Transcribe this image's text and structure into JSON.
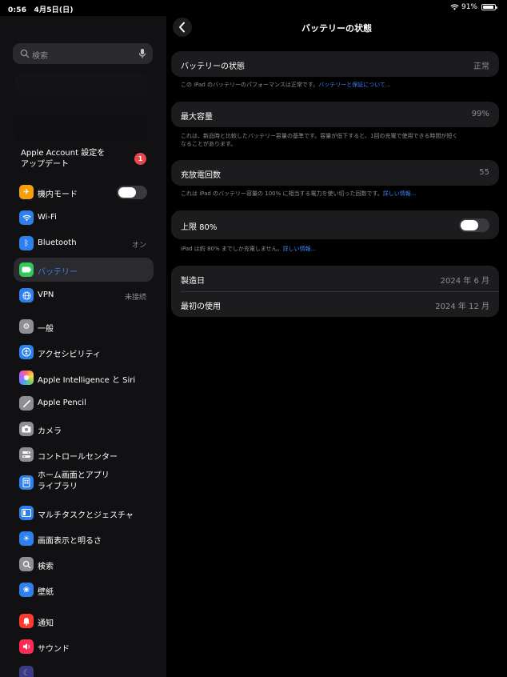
{
  "status_bar": {
    "time": "0:56",
    "date": "4月5日(日)",
    "battery": "91%"
  },
  "sidebar": {
    "search_placeholder": "検索",
    "account": {
      "line1": "Apple Account 設定を",
      "line2": "アップデート",
      "badge": "1"
    },
    "items": [
      {
        "id": "airplane",
        "label": "機内モード",
        "icon": "airplane-icon",
        "color": "#f59e0b",
        "toggle": false
      },
      {
        "id": "wifi",
        "label": "Wi-Fi",
        "icon": "wifi-icon",
        "color": "#2f80ed"
      },
      {
        "id": "bluetooth",
        "label": "Bluetooth",
        "value": "オン",
        "icon": "bluetooth-icon",
        "color": "#2f80ed"
      },
      {
        "id": "battery",
        "label": "バッテリー",
        "icon": "battery-icon",
        "color": "#34c759",
        "selected": true
      },
      {
        "id": "vpn",
        "label": "VPN",
        "value": "未接続",
        "icon": "globe-icon",
        "color": "#2f80ed"
      },
      {
        "id": "general",
        "label": "一般",
        "icon": "gear-icon",
        "color": "#8e8e93"
      },
      {
        "id": "accessibility",
        "label": "アクセシビリティ",
        "icon": "accessibility-icon",
        "color": "#2f80ed"
      },
      {
        "id": "ai",
        "label": "Apple Intelligence と Siri",
        "icon": "siri-icon",
        "color": "#c45cff"
      },
      {
        "id": "pencil",
        "label": "Apple Pencil",
        "icon": "pencil-icon",
        "color": "#8e8e93"
      },
      {
        "id": "camera",
        "label": "カメラ",
        "icon": "camera-icon",
        "color": "#8e8e93"
      },
      {
        "id": "control",
        "label": "コントロールセンター",
        "icon": "control-center-icon",
        "color": "#8e8e93"
      },
      {
        "id": "home",
        "label_line1": "ホーム画面とアプリ",
        "label_line2": "ライブラリ",
        "icon": "home-screen-icon",
        "color": "#2f80ed"
      },
      {
        "id": "multitask",
        "label": "マルチタスクとジェスチャ",
        "icon": "multitask-icon",
        "color": "#2f80ed"
      },
      {
        "id": "display",
        "label": "画面表示と明るさ",
        "icon": "brightness-icon",
        "color": "#2f80ed"
      },
      {
        "id": "search",
        "label": "検索",
        "icon": "search-icon",
        "color": "#8e8e93"
      },
      {
        "id": "wallpaper",
        "label": "壁紙",
        "icon": "wallpaper-icon",
        "color": "#2f80ed"
      },
      {
        "id": "notifications",
        "label": "通知",
        "icon": "bell-icon",
        "color": "#ff3b30"
      },
      {
        "id": "sound",
        "label": "サウンド",
        "icon": "speaker-icon",
        "color": "#ff2d55"
      }
    ]
  },
  "main": {
    "title": "バッテリーの状態",
    "health": {
      "label": "バッテリーの状態",
      "value": "正常",
      "note": "この iPad のバッテリーのパフォーマンスは正常です。",
      "note_link": "バッテリーと保証について..."
    },
    "capacity": {
      "label": "最大容量",
      "value": "99%",
      "note_line1": "これは、新品時と比較したバッテリー容量の基準です。容量が低下すると、1回の充電で使用できる時間が短く",
      "note_line2": "なることがあります。"
    },
    "cycles": {
      "label": "充放電回数",
      "value": "55",
      "note": "これは iPad のバッテリー容量の 100% に相当する電力を使い切った回数です。",
      "note_link": "詳しい情報..."
    },
    "limit": {
      "label": "上限 80%",
      "toggle": false,
      "note": "iPad は約 80% までしか充電しません。",
      "note_link": "詳しい情報..."
    },
    "info": [
      {
        "label": "製造日",
        "value": "2024 年 6 月"
      },
      {
        "label": "最初の使用",
        "value": "2024 年 12 月"
      }
    ]
  }
}
